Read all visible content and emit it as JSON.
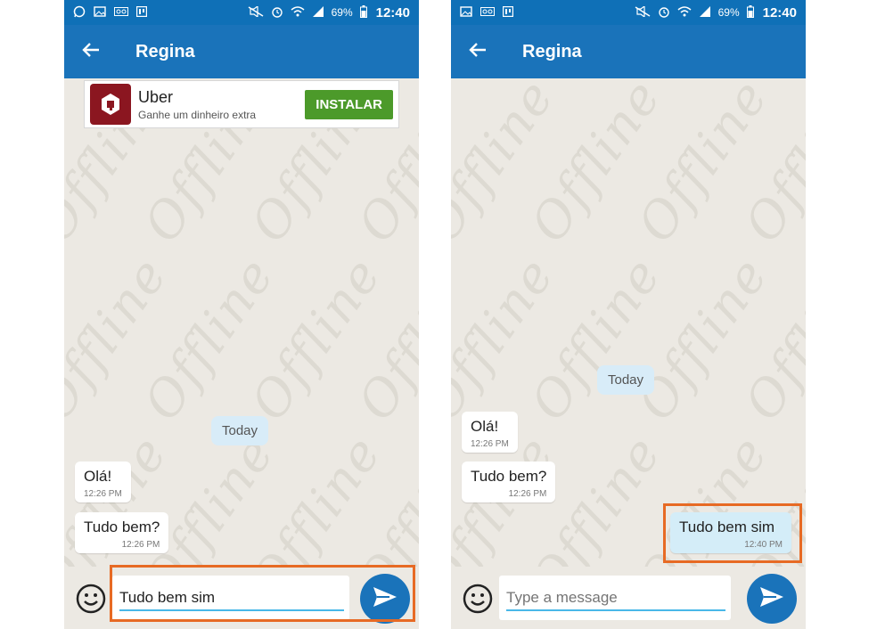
{
  "colors": {
    "accent": "#1a73ba",
    "highlight": "#e76a24",
    "outgoing_bubble": "#d4edf8",
    "install_button": "#4c9a2a"
  },
  "statusbar": {
    "battery": "69%",
    "time": "12:40",
    "icons": [
      "whatsapp-icon",
      "image-icon",
      "voicemail-icon",
      "app-icon",
      "mute-icon",
      "alarm-icon",
      "wifi-icon",
      "signal-icon",
      "battery-icon"
    ]
  },
  "watermark": "Offline",
  "left": {
    "title": "Regina",
    "ad": {
      "title": "Uber",
      "subtitle": "Ganhe um dinheiro extra",
      "button": "INSTALAR"
    },
    "day_label": "Today",
    "messages": [
      {
        "text": "Olá!",
        "time": "12:26 PM"
      },
      {
        "text": "Tudo bem?",
        "time": "12:26 PM"
      }
    ],
    "input_value": "Tudo bem sim"
  },
  "right": {
    "title": "Regina",
    "day_label": "Today",
    "messages": [
      {
        "text": "Olá!",
        "time": "12:26 PM"
      },
      {
        "text": "Tudo bem?",
        "time": "12:26 PM"
      },
      {
        "text": "Tudo bem sim",
        "time": "12:40 PM"
      }
    ],
    "input_placeholder": "Type a message"
  }
}
